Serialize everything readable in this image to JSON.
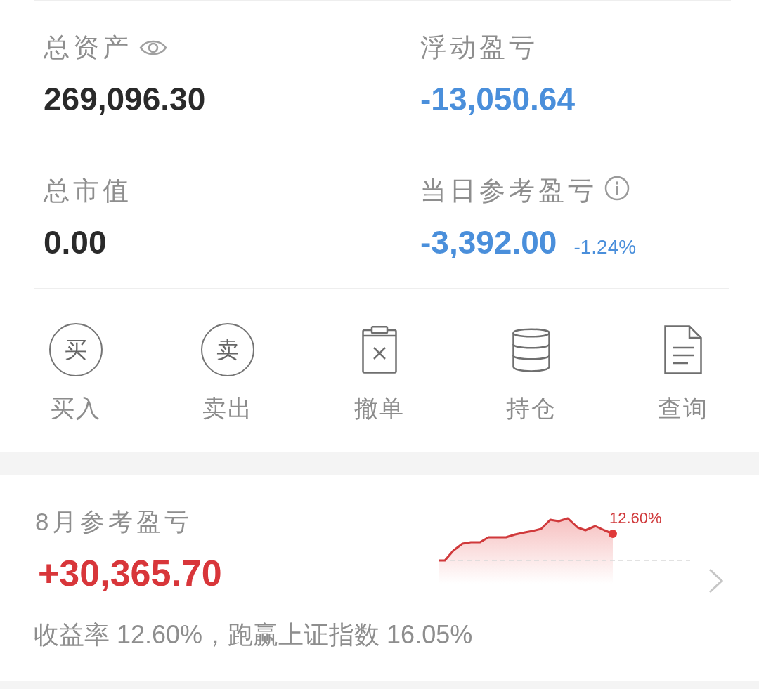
{
  "summary": {
    "items": [
      {
        "label": "总资产",
        "value": "269,096.30",
        "color": "#2a2a2a",
        "kind": "toggle"
      },
      {
        "label": "浮动盈亏",
        "value": "-13,050.64",
        "color": "#4a8fdb",
        "kind": "plain"
      },
      {
        "label": "总市值",
        "value": "0.00",
        "color": "#2a2a2a",
        "kind": "plain"
      },
      {
        "label": "当日参考盈亏",
        "value": "-3,392.00",
        "color": "#4a8fdb",
        "kind": "help",
        "change": "-1.24%"
      }
    ]
  },
  "actions": [
    {
      "label": "买入",
      "kind": "glyph",
      "glyph": "买"
    },
    {
      "label": "卖出",
      "kind": "glyph",
      "glyph": "卖"
    },
    {
      "label": "撤单",
      "kind": "cancel"
    },
    {
      "label": "持仓",
      "kind": "stack"
    },
    {
      "label": "查询",
      "kind": "document"
    }
  ],
  "monthly": {
    "title": "8月参考盈亏",
    "value": "+30,365.70",
    "end_label": "12.60%",
    "summary": "收益率 12.60%，跑赢上证指数 16.05%"
  }
}
